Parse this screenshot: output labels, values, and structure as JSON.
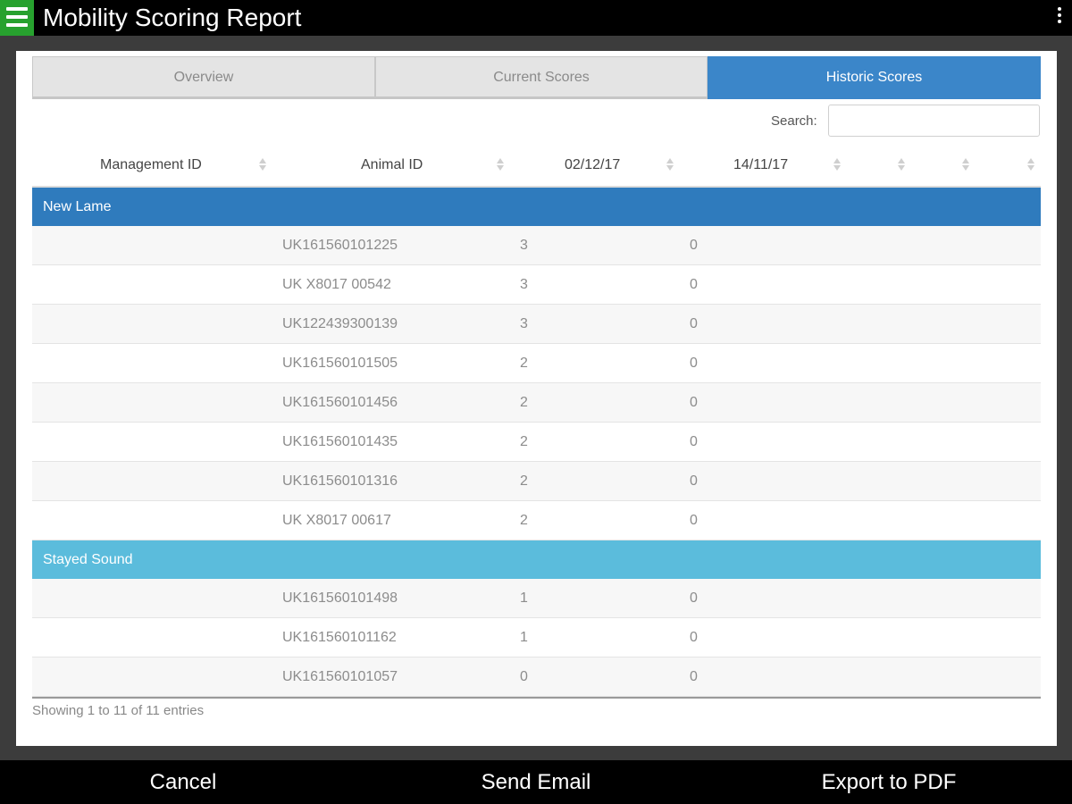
{
  "app": {
    "title": "Mobility Scoring Report"
  },
  "tabs": [
    {
      "label": "Overview",
      "active": false
    },
    {
      "label": "Current Scores",
      "active": false
    },
    {
      "label": "Historic Scores",
      "active": true
    }
  ],
  "search": {
    "label": "Search:",
    "value": ""
  },
  "table": {
    "columns": [
      "Management ID",
      "Animal ID",
      "02/12/17",
      "14/11/17",
      "",
      "",
      ""
    ],
    "groups": [
      {
        "name": "New Lame",
        "color": "#2f7bbd",
        "rows": [
          {
            "management_id": "",
            "animal_id": "UK161560101225",
            "score_1": "3",
            "score_2": "0"
          },
          {
            "management_id": "",
            "animal_id": "UK X8017 00542",
            "score_1": "3",
            "score_2": "0"
          },
          {
            "management_id": "",
            "animal_id": "UK122439300139",
            "score_1": "3",
            "score_2": "0"
          },
          {
            "management_id": "",
            "animal_id": "UK161560101505",
            "score_1": "2",
            "score_2": "0"
          },
          {
            "management_id": "",
            "animal_id": "UK161560101456",
            "score_1": "2",
            "score_2": "0"
          },
          {
            "management_id": "",
            "animal_id": "UK161560101435",
            "score_1": "2",
            "score_2": "0"
          },
          {
            "management_id": "",
            "animal_id": "UK161560101316",
            "score_1": "2",
            "score_2": "0"
          },
          {
            "management_id": "",
            "animal_id": "UK X8017 00617",
            "score_1": "2",
            "score_2": "0"
          }
        ]
      },
      {
        "name": "Stayed Sound",
        "color": "#5bbcdc",
        "rows": [
          {
            "management_id": "",
            "animal_id": "UK161560101498",
            "score_1": "1",
            "score_2": "0"
          },
          {
            "management_id": "",
            "animal_id": "UK161560101162",
            "score_1": "1",
            "score_2": "0"
          },
          {
            "management_id": "",
            "animal_id": "UK161560101057",
            "score_1": "0",
            "score_2": "0"
          }
        ]
      }
    ]
  },
  "info": "Showing 1 to 11 of 11 entries",
  "actions": {
    "cancel": "Cancel",
    "send_email": "Send Email",
    "export_pdf": "Export to PDF"
  },
  "colors": {
    "accent": "#3b86c9",
    "menu": "#27a12e",
    "new_lame": "#2f7bbd",
    "stayed_sound": "#5bbcdc"
  },
  "icons": {
    "menu": "hamburger-menu-icon",
    "overflow": "overflow-menu-icon",
    "sort": "sort-icon"
  }
}
